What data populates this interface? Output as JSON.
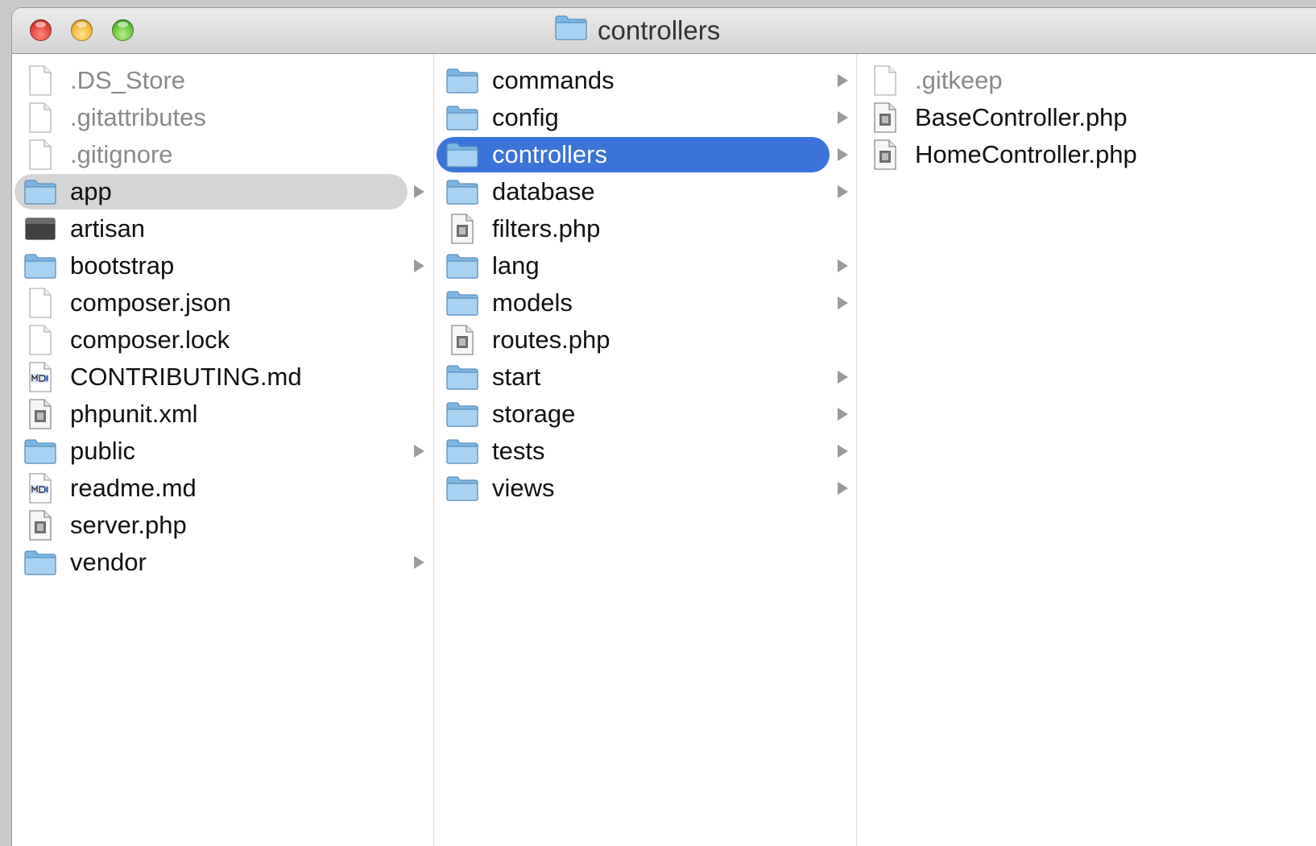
{
  "window": {
    "title": "controllers",
    "title_icon": "folder-icon"
  },
  "colors": {
    "selection_active": "#3a74d9",
    "selection_inactive": "#d5d5d5",
    "folder": "#8cc1ea",
    "dim_text": "#8a8a8a"
  },
  "columns": [
    {
      "items": [
        {
          "label": ".DS_Store",
          "icon": "file-icon",
          "dim": true
        },
        {
          "label": ".gitattributes",
          "icon": "file-icon",
          "dim": true
        },
        {
          "label": ".gitignore",
          "icon": "file-icon",
          "dim": true
        },
        {
          "label": "app",
          "icon": "folder-icon",
          "folder": true,
          "selected": "inactive"
        },
        {
          "label": "artisan",
          "icon": "terminal-icon"
        },
        {
          "label": "bootstrap",
          "icon": "folder-icon",
          "folder": true
        },
        {
          "label": "composer.json",
          "icon": "file-icon"
        },
        {
          "label": "composer.lock",
          "icon": "file-icon"
        },
        {
          "label": "CONTRIBUTING.md",
          "icon": "markdown-file-icon"
        },
        {
          "label": "phpunit.xml",
          "icon": "script-file-icon"
        },
        {
          "label": "public",
          "icon": "folder-icon",
          "folder": true
        },
        {
          "label": "readme.md",
          "icon": "markdown-file-icon"
        },
        {
          "label": "server.php",
          "icon": "script-file-icon"
        },
        {
          "label": "vendor",
          "icon": "folder-icon",
          "folder": true
        }
      ]
    },
    {
      "items": [
        {
          "label": "commands",
          "icon": "folder-icon",
          "folder": true
        },
        {
          "label": "config",
          "icon": "folder-icon",
          "folder": true
        },
        {
          "label": "controllers",
          "icon": "folder-icon",
          "folder": true,
          "selected": "active"
        },
        {
          "label": "database",
          "icon": "folder-icon",
          "folder": true
        },
        {
          "label": "filters.php",
          "icon": "script-file-icon"
        },
        {
          "label": "lang",
          "icon": "folder-icon",
          "folder": true
        },
        {
          "label": "models",
          "icon": "folder-icon",
          "folder": true
        },
        {
          "label": "routes.php",
          "icon": "script-file-icon"
        },
        {
          "label": "start",
          "icon": "folder-icon",
          "folder": true
        },
        {
          "label": "storage",
          "icon": "folder-icon",
          "folder": true
        },
        {
          "label": "tests",
          "icon": "folder-icon",
          "folder": true
        },
        {
          "label": "views",
          "icon": "folder-icon",
          "folder": true
        }
      ]
    },
    {
      "items": [
        {
          "label": ".gitkeep",
          "icon": "file-icon",
          "dim": true
        },
        {
          "label": "BaseController.php",
          "icon": "script-file-icon"
        },
        {
          "label": "HomeController.php",
          "icon": "script-file-icon"
        }
      ]
    }
  ]
}
